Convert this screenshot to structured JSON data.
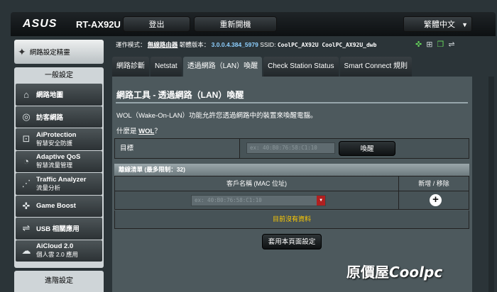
{
  "header": {
    "logo": "ASUS",
    "model": "RT-AX92U",
    "logout_label": "登出",
    "reboot_label": "重新開機",
    "language": "繁體中文"
  },
  "status": {
    "mode_label": "運作模式：",
    "mode_value": "無線路由器",
    "fw_label": "韌體版本：",
    "fw_value": "3.0.0.4.384_5979",
    "ssid_label": "SSID:",
    "ssid_1": "CoolPC_AX92U",
    "ssid_2": "CoolPC_AX92U_dwb"
  },
  "sidebar": {
    "quick_setup": "網路設定精靈",
    "general_head": "一般設定",
    "items": [
      {
        "t1": "網路地圖",
        "t2": ""
      },
      {
        "t1": "訪客網路",
        "t2": ""
      },
      {
        "t1": "AiProtection",
        "t2": "智慧安全防護"
      },
      {
        "t1": "Adaptive QoS",
        "t2": "智慧流量管理"
      },
      {
        "t1": "Traffic Analyzer",
        "t2": "流量分析"
      },
      {
        "t1": "Game Boost",
        "t2": ""
      },
      {
        "t1": "USB 相關應用",
        "t2": ""
      },
      {
        "t1": "AiCloud 2.0",
        "t2": "個人雲 2.0 應用"
      }
    ],
    "advanced_head": "進階設定"
  },
  "tabs": [
    "網路診斷",
    "Netstat",
    "透過網路（LAN）喚醒",
    "Check Station Status",
    "Smart Connect 規則"
  ],
  "active_tab": 2,
  "main": {
    "title": "網路工具 - 透過網路（LAN）喚醒",
    "desc": "WOL（Wake-On-LAN）功能允許您透過網路中的裝置來喚醒電腦。",
    "whatis_prefix": "什麼是",
    "whatis_link": "WOL",
    "whatis_suffix": "？",
    "target_label": "目標",
    "target_placeholder": "ex: 40:B0:76:58:C1:10",
    "wake_label": "喚醒",
    "list_head": "離線清單 (最多限制：32)",
    "col_client": "客戶名稱 (MAC 位址)",
    "col_action": "新增 / 移除",
    "client_placeholder": "ex: 40:B0:76:58:C1:10",
    "empty_text": "目前沒有資料",
    "apply_label": "套用本頁面設定"
  },
  "watermark": {
    "prefix": "原價屋",
    "brand": "Coolpc"
  }
}
